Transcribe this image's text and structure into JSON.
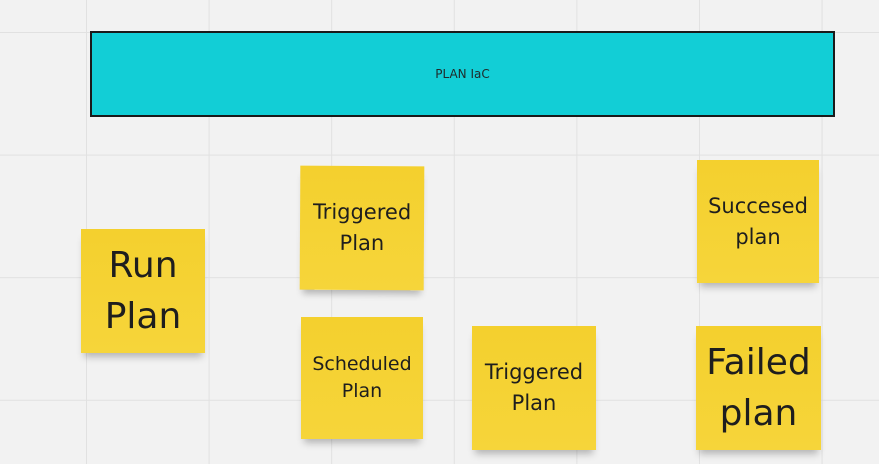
{
  "banner": {
    "label": "PLAN IaC",
    "color": "#12ced6"
  },
  "stickies": {
    "run_plan": "Run\nPlan",
    "triggered_plan_1": "Triggered\nPlan",
    "scheduled_plan": "Scheduled\nPlan",
    "triggered_plan_2": "Triggered\nPlan",
    "succeeded_plan": "Succesed\nplan",
    "failed_plan": "Failed\nplan",
    "color": "#f5d236"
  }
}
